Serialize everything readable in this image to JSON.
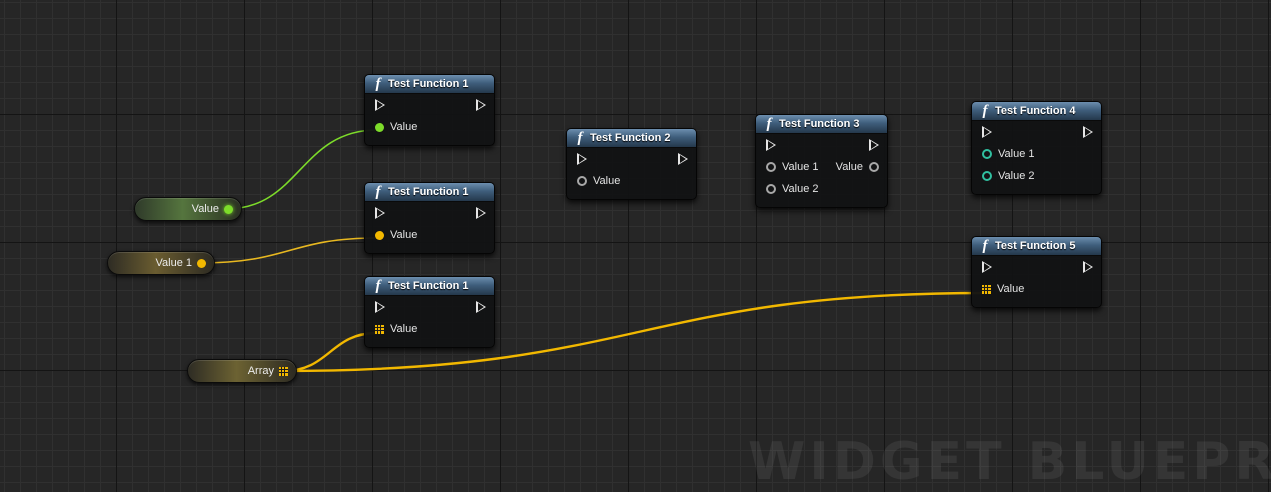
{
  "colors": {
    "bool_pin": "#7ddc2a",
    "int_pin": "#f2b800",
    "array_pin": "#f2b800",
    "unconnected_pin": "#a8a8a8",
    "struct_pin": "#30c0a0",
    "exec_pin": "#e6e6e6",
    "function_header": "#3f5e7c"
  },
  "variables": [
    {
      "label": "Value",
      "pin_type": "bool",
      "pin_icon": "filled-circle"
    },
    {
      "label": "Value 1",
      "pin_type": "int",
      "pin_icon": "filled-circle"
    },
    {
      "label": "Array",
      "pin_type": "array",
      "pin_icon": "grid"
    }
  ],
  "nodes": [
    {
      "title": "Test Function 1",
      "icon": "function-icon",
      "inputs": [
        "Value"
      ],
      "outputs": []
    },
    {
      "title": "Test Function 1",
      "icon": "function-icon",
      "inputs": [
        "Value"
      ],
      "outputs": []
    },
    {
      "title": "Test Function 1",
      "icon": "function-icon",
      "inputs": [
        "Value"
      ],
      "outputs": []
    },
    {
      "title": "Test Function 2",
      "icon": "function-icon",
      "inputs": [
        "Value"
      ],
      "outputs": []
    },
    {
      "title": "Test Function 3",
      "icon": "function-icon",
      "inputs": [
        "Value 1",
        "Value 2"
      ],
      "outputs": [
        "Value"
      ]
    },
    {
      "title": "Test Function 4",
      "icon": "function-icon",
      "inputs": [
        "Value 1",
        "Value 2"
      ],
      "outputs": []
    },
    {
      "title": "Test Function 5",
      "icon": "function-icon",
      "inputs": [
        "Value"
      ],
      "outputs": []
    }
  ],
  "watermark": "WIDGET BLUEPR"
}
